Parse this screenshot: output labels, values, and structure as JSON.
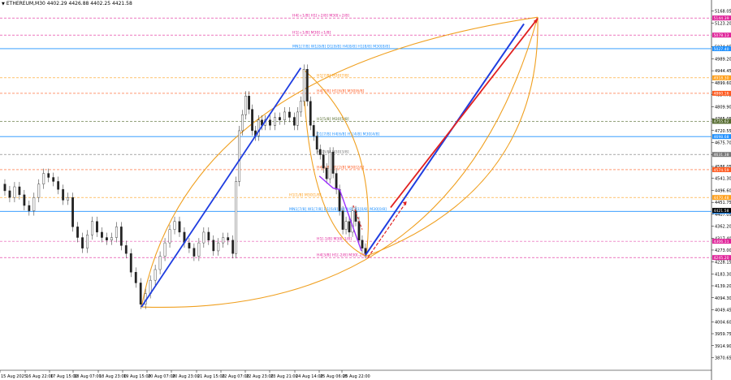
{
  "header": {
    "symbol_label": "ETHEREUM,M30",
    "ohlc": "4402.29 4426.88 4402.25 4421.58"
  },
  "chart_data": {
    "type": "candlestick",
    "symbol": "ETHEREUM",
    "timeframe": "M30",
    "ylim": [
      3826,
      5185
    ],
    "xlim": [
      0,
      880
    ],
    "price_ticks": [
      5168.05,
      5123.2,
      5034.05,
      4989.2,
      4944.45,
      4899.6,
      4854.75,
      4809.9,
      4765.05,
      4720.55,
      4675.7,
      4630.9,
      4586.05,
      4541.3,
      4496.6,
      4451.75,
      4407.05,
      4362.2,
      4317.4,
      4273.0,
      4228.15,
      4183.3,
      4139.2,
      4094.3,
      4049.45,
      4004.6,
      3959.75,
      3914.9,
      3870.65
    ],
    "time_labels": [
      {
        "x": 0,
        "label": "15 Aug 2025"
      },
      {
        "x": 1,
        "label": "16 Aug 22:00"
      },
      {
        "x": 2,
        "label": "17 Aug 15:00"
      },
      {
        "x": 3,
        "label": "18 Aug 07:00"
      },
      {
        "x": 4,
        "label": "18 Aug 23:00"
      },
      {
        "x": 5,
        "label": "19 Aug 15:00"
      },
      {
        "x": 6,
        "label": "20 Aug 07:00"
      },
      {
        "x": 7,
        "label": "20 Aug 23:00"
      },
      {
        "x": 8,
        "label": "21 Aug 15:00"
      },
      {
        "x": 9,
        "label": "22 Aug 07:00"
      },
      {
        "x": 10,
        "label": "22 Aug 23:00"
      },
      {
        "x": 11,
        "label": "23 Aug 21:00"
      },
      {
        "x": 12,
        "label": "24 Aug 14:00"
      },
      {
        "x": 13,
        "label": "25 Aug 06:00"
      },
      {
        "x": 14,
        "label": "25 Aug 22:00"
      }
    ],
    "levels": [
      {
        "label": "H4[+1/8] H1[+2/8] M30[+2/8]",
        "price": 5142,
        "color": "#e0249a",
        "dash": true,
        "badge": "5144.39"
      },
      {
        "label": "H1[+1/8] M30[+1/8]",
        "price": 5078,
        "color": "#e0249a",
        "dash": true,
        "badge": "5078.13"
      },
      {
        "label": "MN1[7/8] W1[8/8] D1[8/8] H4[8/8] H1[8/8] M30[8/8]",
        "price": 5027,
        "color": "#1e90ff",
        "dash": false,
        "badge": "5027.40"
      },
      {
        "label": "H1[7/8] M30[7/8]",
        "price": 4918,
        "color": "#ff9f1a",
        "dash": true,
        "badge": "4918.30"
      },
      {
        "label": "H4[7/8] H1[6/8] M30[6/8]",
        "price": 4860,
        "color": "#ff5a1f",
        "dash": true,
        "badge": "4860.16"
      },
      {
        "label": "H1[5/8] M30[5/8]",
        "price": 4755,
        "color": "#556b2f",
        "dash": true,
        "badge": "4755.62"
      },
      {
        "label": "D1[7/8] H4[6/8] H1[4/8] M30[4/8]",
        "price": 4698,
        "color": "#1e90ff",
        "dash": false,
        "badge": "4698.68"
      },
      {
        "label": "H1[3/8] M30[3/8]",
        "price": 4631,
        "color": "#777777",
        "dash": true,
        "badge": "4631.38"
      },
      {
        "label": "H4[5/8] H1[2/8] M30[2/8]",
        "price": 4574,
        "color": "#ff5a1f",
        "dash": true,
        "badge": "4574.59"
      },
      {
        "label": "H1[1/8] M30[1/8]",
        "price": 4470,
        "color": "#ff9f1a",
        "dash": true,
        "badge": "4470.48"
      },
      {
        "label": "MN1[7/8] W1[7/8] D1[6/8] H4[4/8] H1[0/8] M30[0/8]",
        "price": 4418,
        "color": "#1e90ff",
        "dash": false,
        "badge": "4418.23"
      },
      {
        "label": "H1[-1/8] M30[-1/8]",
        "price": 4306,
        "color": "#e0249a",
        "dash": true,
        "badge": "4306.11"
      },
      {
        "label": "H4[3/8] H1[-2/8] M30[-2/8]",
        "price": 4245,
        "color": "#e0249a",
        "dash": true,
        "badge": "4245.20"
      }
    ],
    "current_price": {
      "value": 4421.58,
      "badge": "4421.58"
    },
    "prices": [
      [
        0,
        4520
      ],
      [
        6,
        4495
      ],
      [
        12,
        4470
      ],
      [
        18,
        4510
      ],
      [
        24,
        4480
      ],
      [
        30,
        4440
      ],
      [
        36,
        4420
      ],
      [
        42,
        4470
      ],
      [
        48,
        4520
      ],
      [
        54,
        4560
      ],
      [
        60,
        4545
      ],
      [
        66,
        4530
      ],
      [
        72,
        4500
      ],
      [
        78,
        4460
      ],
      [
        84,
        4470
      ],
      [
        90,
        4360
      ],
      [
        96,
        4320
      ],
      [
        102,
        4280
      ],
      [
        108,
        4330
      ],
      [
        114,
        4380
      ],
      [
        120,
        4340
      ],
      [
        126,
        4320
      ],
      [
        132,
        4310
      ],
      [
        138,
        4320
      ],
      [
        144,
        4360
      ],
      [
        150,
        4290
      ],
      [
        156,
        4260
      ],
      [
        162,
        4190
      ],
      [
        168,
        4150
      ],
      [
        174,
        4070
      ],
      [
        180,
        4110
      ],
      [
        186,
        4160
      ],
      [
        192,
        4200
      ],
      [
        198,
        4250
      ],
      [
        204,
        4300
      ],
      [
        210,
        4350
      ],
      [
        216,
        4380
      ],
      [
        222,
        4340
      ],
      [
        228,
        4300
      ],
      [
        234,
        4280
      ],
      [
        240,
        4250
      ],
      [
        246,
        4300
      ],
      [
        252,
        4340
      ],
      [
        258,
        4310
      ],
      [
        264,
        4270
      ],
      [
        270,
        4300
      ],
      [
        276,
        4320
      ],
      [
        282,
        4310
      ],
      [
        288,
        4260
      ],
      [
        292,
        4530
      ],
      [
        296,
        4720
      ],
      [
        300,
        4780
      ],
      [
        304,
        4850
      ],
      [
        308,
        4800
      ],
      [
        312,
        4720
      ],
      [
        316,
        4700
      ],
      [
        320,
        4760
      ],
      [
        324,
        4740
      ],
      [
        328,
        4760
      ],
      [
        334,
        4740
      ],
      [
        340,
        4770
      ],
      [
        346,
        4760
      ],
      [
        352,
        4790
      ],
      [
        358,
        4770
      ],
      [
        364,
        4740
      ],
      [
        368,
        4790
      ],
      [
        372,
        4830
      ],
      [
        376,
        4950
      ],
      [
        380,
        4830
      ],
      [
        384,
        4740
      ],
      [
        388,
        4700
      ],
      [
        392,
        4650
      ],
      [
        396,
        4630
      ],
      [
        400,
        4580
      ],
      [
        404,
        4540
      ],
      [
        408,
        4640
      ],
      [
        412,
        4560
      ],
      [
        416,
        4500
      ],
      [
        420,
        4420
      ],
      [
        424,
        4350
      ],
      [
        428,
        4380
      ],
      [
        432,
        4340
      ],
      [
        436,
        4420
      ],
      [
        440,
        4380
      ],
      [
        444,
        4310
      ],
      [
        448,
        4280
      ],
      [
        452,
        4260
      ]
    ],
    "projection_dashed": [
      [
        455,
        4245
      ],
      [
        470,
        4310
      ],
      [
        503,
        4455
      ]
    ],
    "projection_red": [
      [
        453,
        4250
      ],
      [
        665,
        5140
      ]
    ],
    "projection_blue": [
      [
        452,
        4254
      ],
      [
        648,
        5120
      ]
    ],
    "trend_up": [
      [
        175,
        4060
      ],
      [
        372,
        4955
      ]
    ],
    "annotation_purple": [
      [
        395,
        4550
      ],
      [
        412,
        4505
      ],
      [
        420,
        4500
      ],
      [
        447,
        4270
      ]
    ]
  }
}
